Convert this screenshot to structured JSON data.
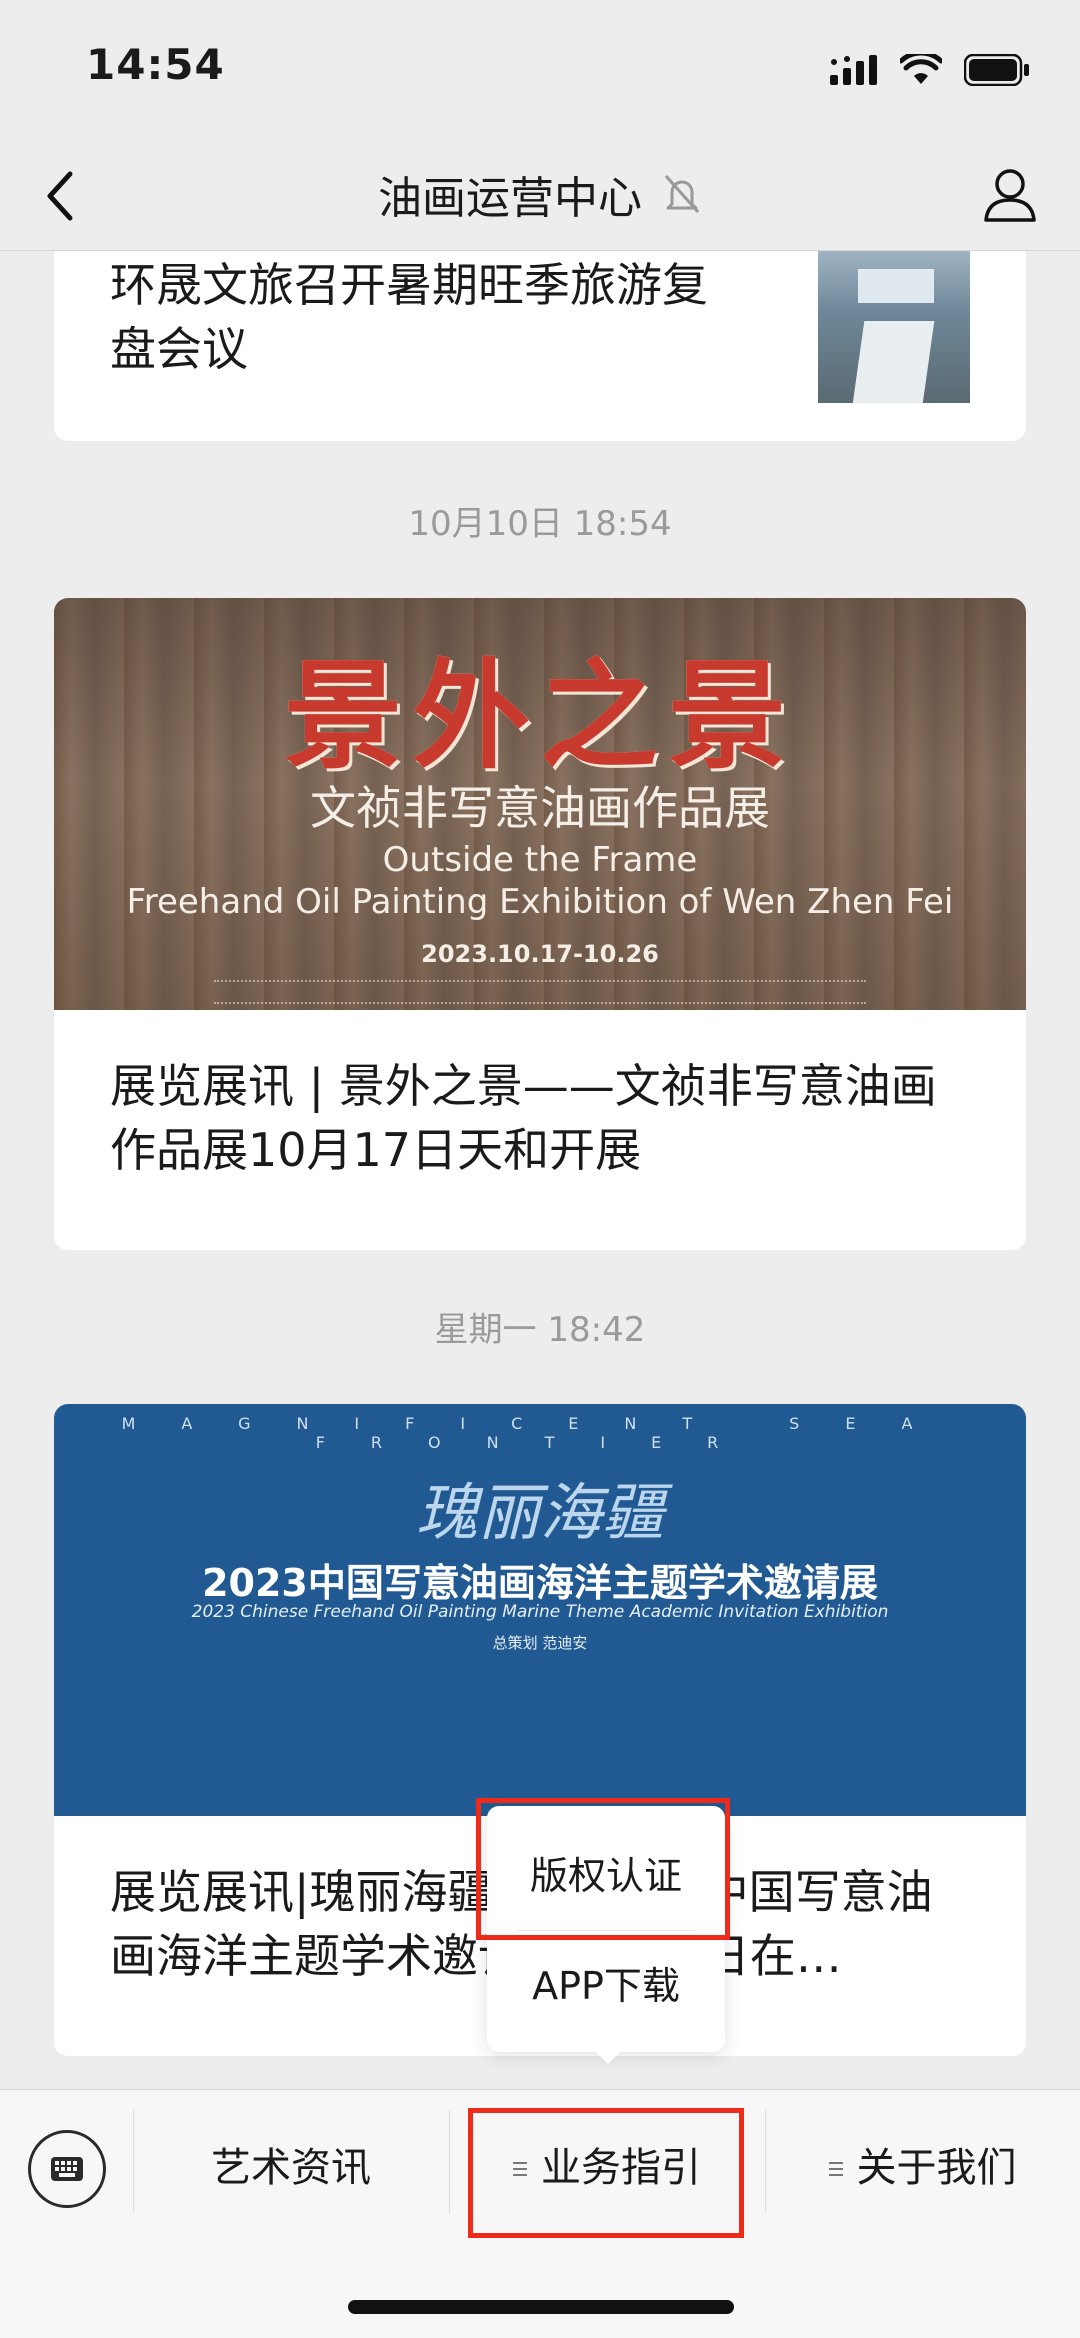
{
  "status_bar": {
    "time": "14:54",
    "icons": [
      "signal-icon",
      "wifi-icon",
      "battery-icon"
    ]
  },
  "nav": {
    "title": "油画运营中心",
    "back_icon": "chevron-left-icon",
    "mute_icon": "bell-slash-icon",
    "profile_icon": "person-icon"
  },
  "feed": {
    "articles": [
      {
        "title": "环晟文旅召开暑期旺季旅游复盘会议",
        "thumbnail": "meeting-room-photo"
      },
      {
        "timestamp": "10月10日 18:54",
        "banner": {
          "title": "景外之景",
          "subtitle": "文祯非写意油画作品展",
          "en_line1": "Outside the Frame",
          "en_line2": "Freehand Oil Painting Exhibition of Wen Zhen Fei",
          "dates": "2023.10.17-10.26"
        },
        "title": "展览展讯 | 景外之景——文祯非写意油画作品展10月17日天和开展"
      },
      {
        "timestamp": "星期一 18:42",
        "banner": {
          "top_text": "MAGNIFICENT SEA FRONTIER",
          "calligraphy": "瑰丽海疆",
          "title": "2023中国写意油画海洋主题学术邀请展",
          "en_title": "2023 Chinese Freehand Oil Painting Marine Theme Academic Invitation Exhibition",
          "credit": "总策划  范迪安"
        },
        "title": "展览展讯|瑰丽海疆——2023中国写意油画海洋主题学术邀请展11月5日在…"
      }
    ]
  },
  "popup_menu": {
    "items": [
      "版权认证",
      "APP下载"
    ]
  },
  "bottom_menu": {
    "keyboard_icon": "keyboard-icon",
    "items": [
      "艺术资讯",
      "业务指引",
      "关于我们"
    ]
  },
  "annotations": {
    "highlight_color": "#ee2b1a"
  }
}
